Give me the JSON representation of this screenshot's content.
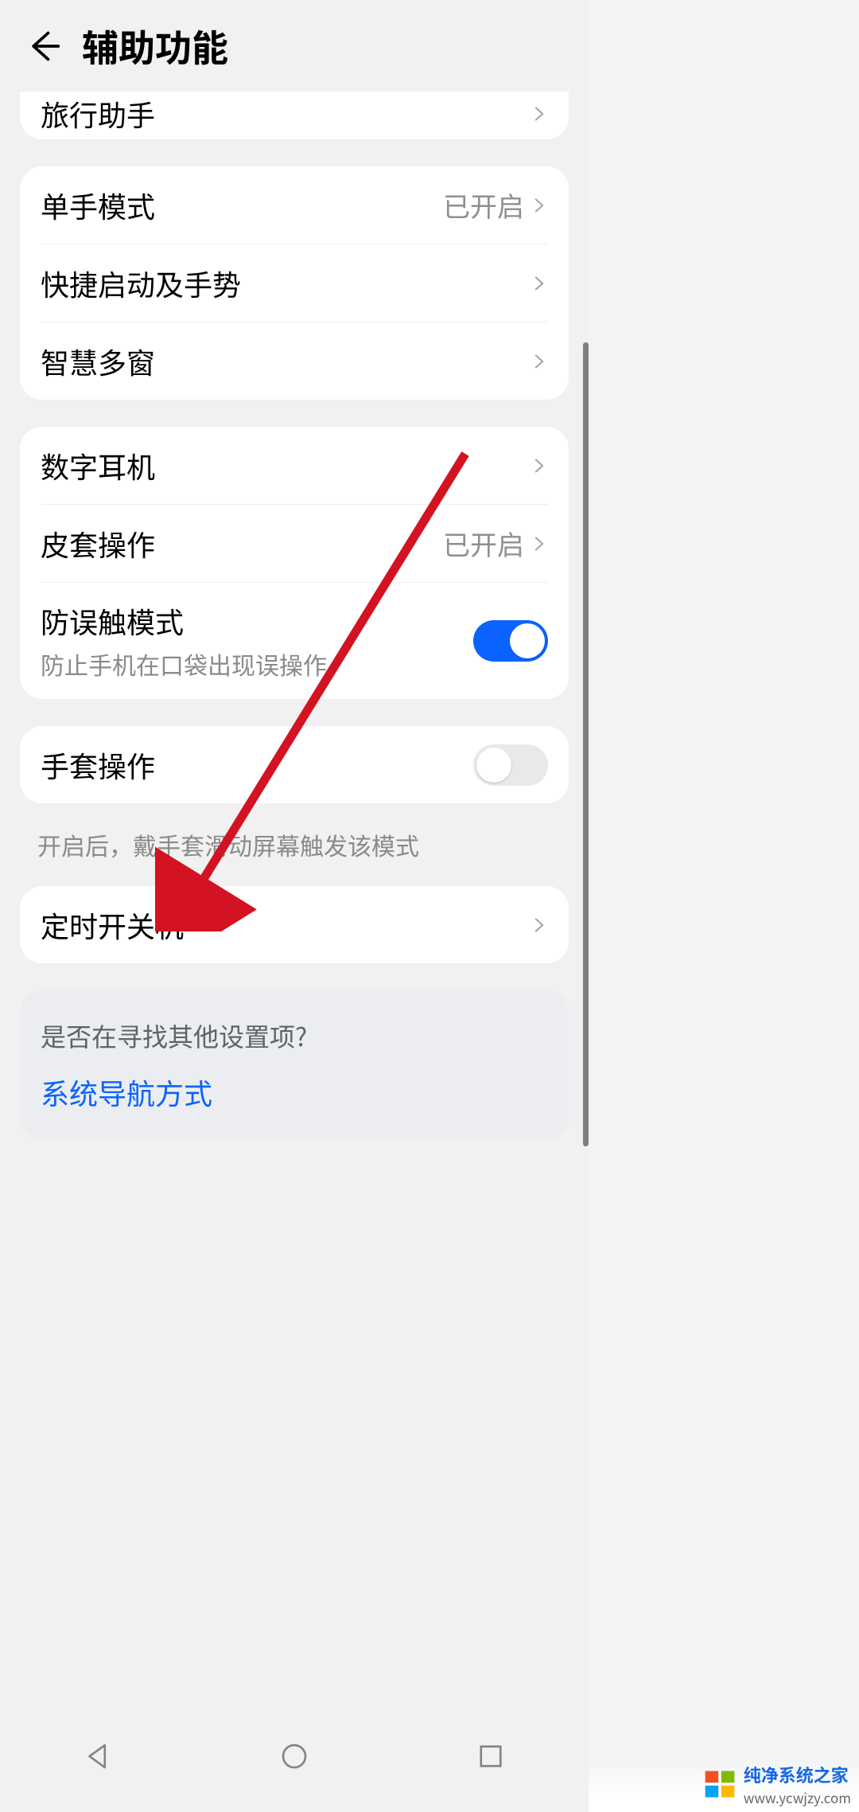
{
  "header": {
    "title": "辅助功能"
  },
  "truncated": {
    "label": "旅行助手"
  },
  "group1": {
    "item1": {
      "label": "单手模式",
      "value": "已开启"
    },
    "item2": {
      "label": "快捷启动及手势"
    },
    "item3": {
      "label": "智慧多窗"
    }
  },
  "group2": {
    "item1": {
      "label": "数字耳机"
    },
    "item2": {
      "label": "皮套操作",
      "value": "已开启"
    },
    "item3": {
      "label": "防误触模式",
      "sub": "防止手机在口袋出现误操作",
      "toggle": true
    }
  },
  "group3": {
    "item1": {
      "label": "手套操作",
      "toggle": false
    }
  },
  "footer_note": "开启后，戴手套滑动屏幕触发该模式",
  "group4": {
    "item1": {
      "label": "定时开关机"
    }
  },
  "suggest": {
    "question": "是否在寻找其他设置项?",
    "link": "系统导航方式"
  },
  "watermark": {
    "line1": "纯净系统之家",
    "line2": "www.ycwjzy.com"
  },
  "colors": {
    "accent": "#0a63ff",
    "arrow": "#d31222"
  }
}
